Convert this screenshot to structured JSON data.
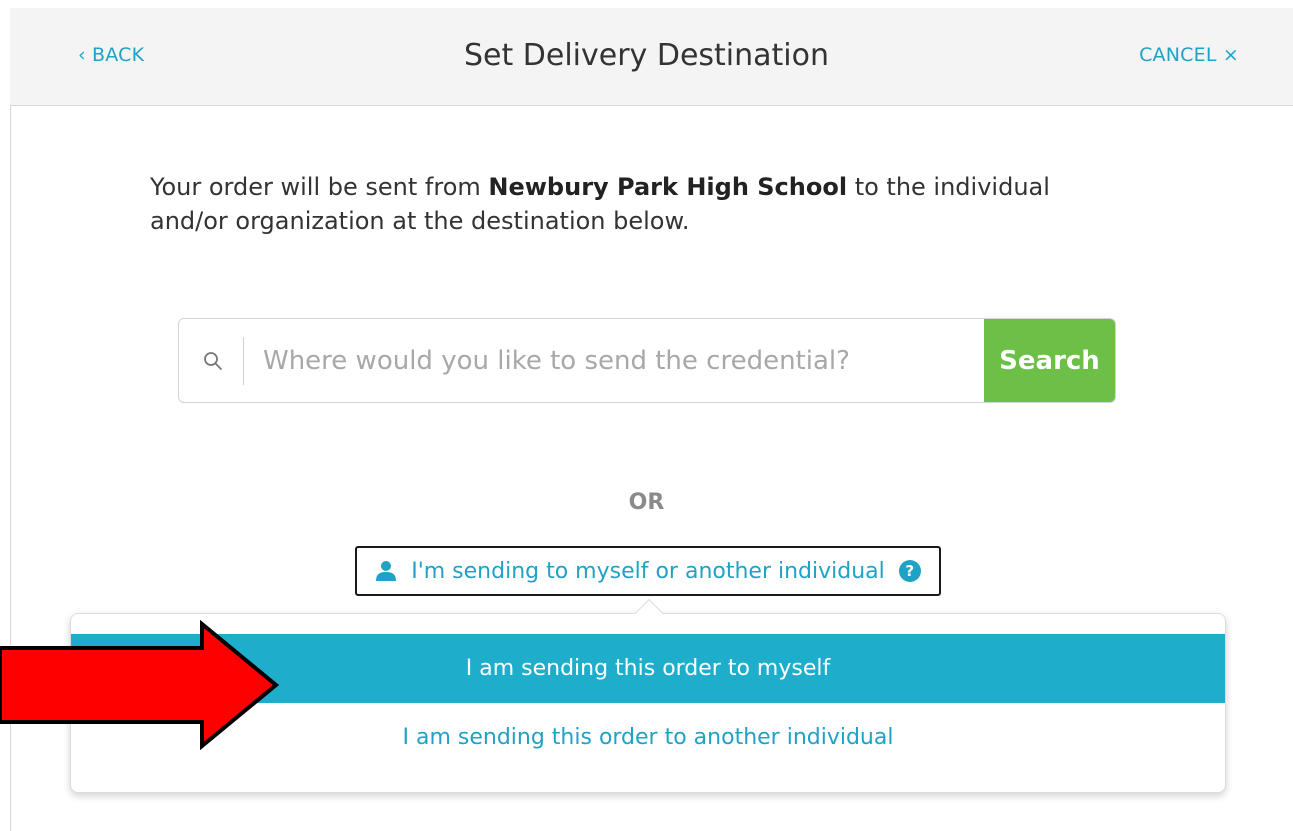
{
  "header": {
    "back_label": "‹ BACK",
    "title": "Set Delivery Destination",
    "cancel_label": "CANCEL ×"
  },
  "intro": {
    "prefix": "Your order will be sent from ",
    "school": "Newbury Park High School",
    "suffix": " to the individual and/or organization at the destination below."
  },
  "search": {
    "placeholder": "Where would you like to send the credential?",
    "value": "",
    "button_label": "Search"
  },
  "or_label": "OR",
  "individual_toggle": {
    "label": "I'm sending to myself or another individual",
    "help_glyph": "?"
  },
  "dropdown": {
    "options": [
      {
        "label": "I am sending this order to myself",
        "highlighted": true
      },
      {
        "label": "I am sending this order to another individual",
        "highlighted": false
      }
    ]
  },
  "colors": {
    "accent": "#1fa2c6",
    "highlight": "#1fadcc",
    "search_button": "#6cbf47",
    "annotation_arrow": "#ff0000"
  },
  "icons": {
    "search": "search-icon",
    "person": "person-icon",
    "help": "help-icon",
    "arrow": "red-arrow-annotation"
  }
}
